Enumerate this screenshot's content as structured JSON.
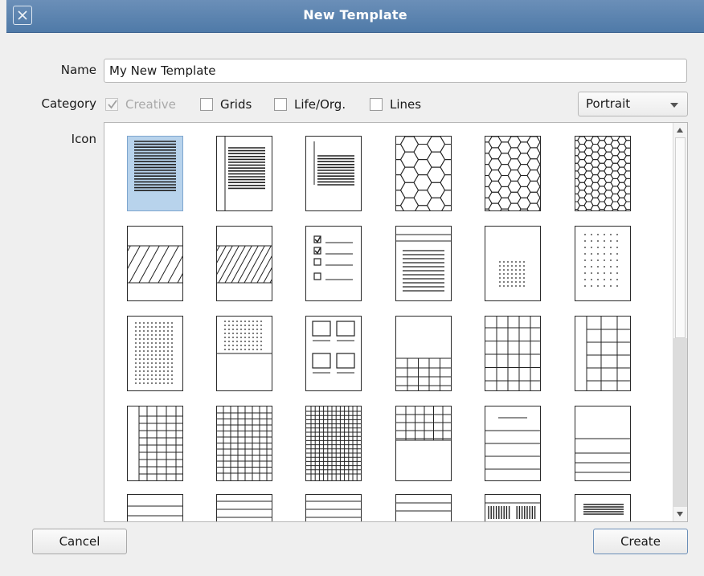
{
  "window": {
    "title": "New Template"
  },
  "form": {
    "name_label": "Name",
    "name_value": "My New Template",
    "category_label": "Category",
    "icon_label": "Icon",
    "categories": [
      {
        "label": "Creative",
        "checked": true,
        "disabled": true
      },
      {
        "label": "Grids",
        "checked": false,
        "disabled": false
      },
      {
        "label": "Life/Org.",
        "checked": false,
        "disabled": false
      },
      {
        "label": "Lines",
        "checked": false,
        "disabled": false
      }
    ],
    "orientation": "Portrait"
  },
  "icons": [
    "lined-paper-icon",
    "lined-paper-margin-icon",
    "lined-paper-margin-left-icon",
    "hexagon-large-icon",
    "hexagon-medium-icon",
    "hexagon-small-icon",
    "diagonal-band-icon",
    "diagonal-band-dense-icon",
    "checklist-icon",
    "ruled-header-icon",
    "dot-block-bottom-icon",
    "dot-grid-sparse-icon",
    "dot-grid-full-icon",
    "dot-block-top-icon",
    "four-box-icon",
    "grid-bottom-icon",
    "grid-full-icon",
    "grid-margin-icon",
    "grid-margin-small-icon",
    "grid-fine-icon",
    "grid-finest-icon",
    "grid-top-icon",
    "lines-with-header-icon",
    "lines-bottom-icon",
    "lines-row-a-icon",
    "lines-row-b-icon",
    "lines-row-c-icon",
    "lines-row-d-icon",
    "barcode-icon",
    "list-block-icon"
  ],
  "selected_icon": "lined-paper-icon",
  "buttons": {
    "cancel": "Cancel",
    "create": "Create"
  },
  "colors": {
    "titlebar": "#5a84b2",
    "selection": "#b8d3ec"
  }
}
